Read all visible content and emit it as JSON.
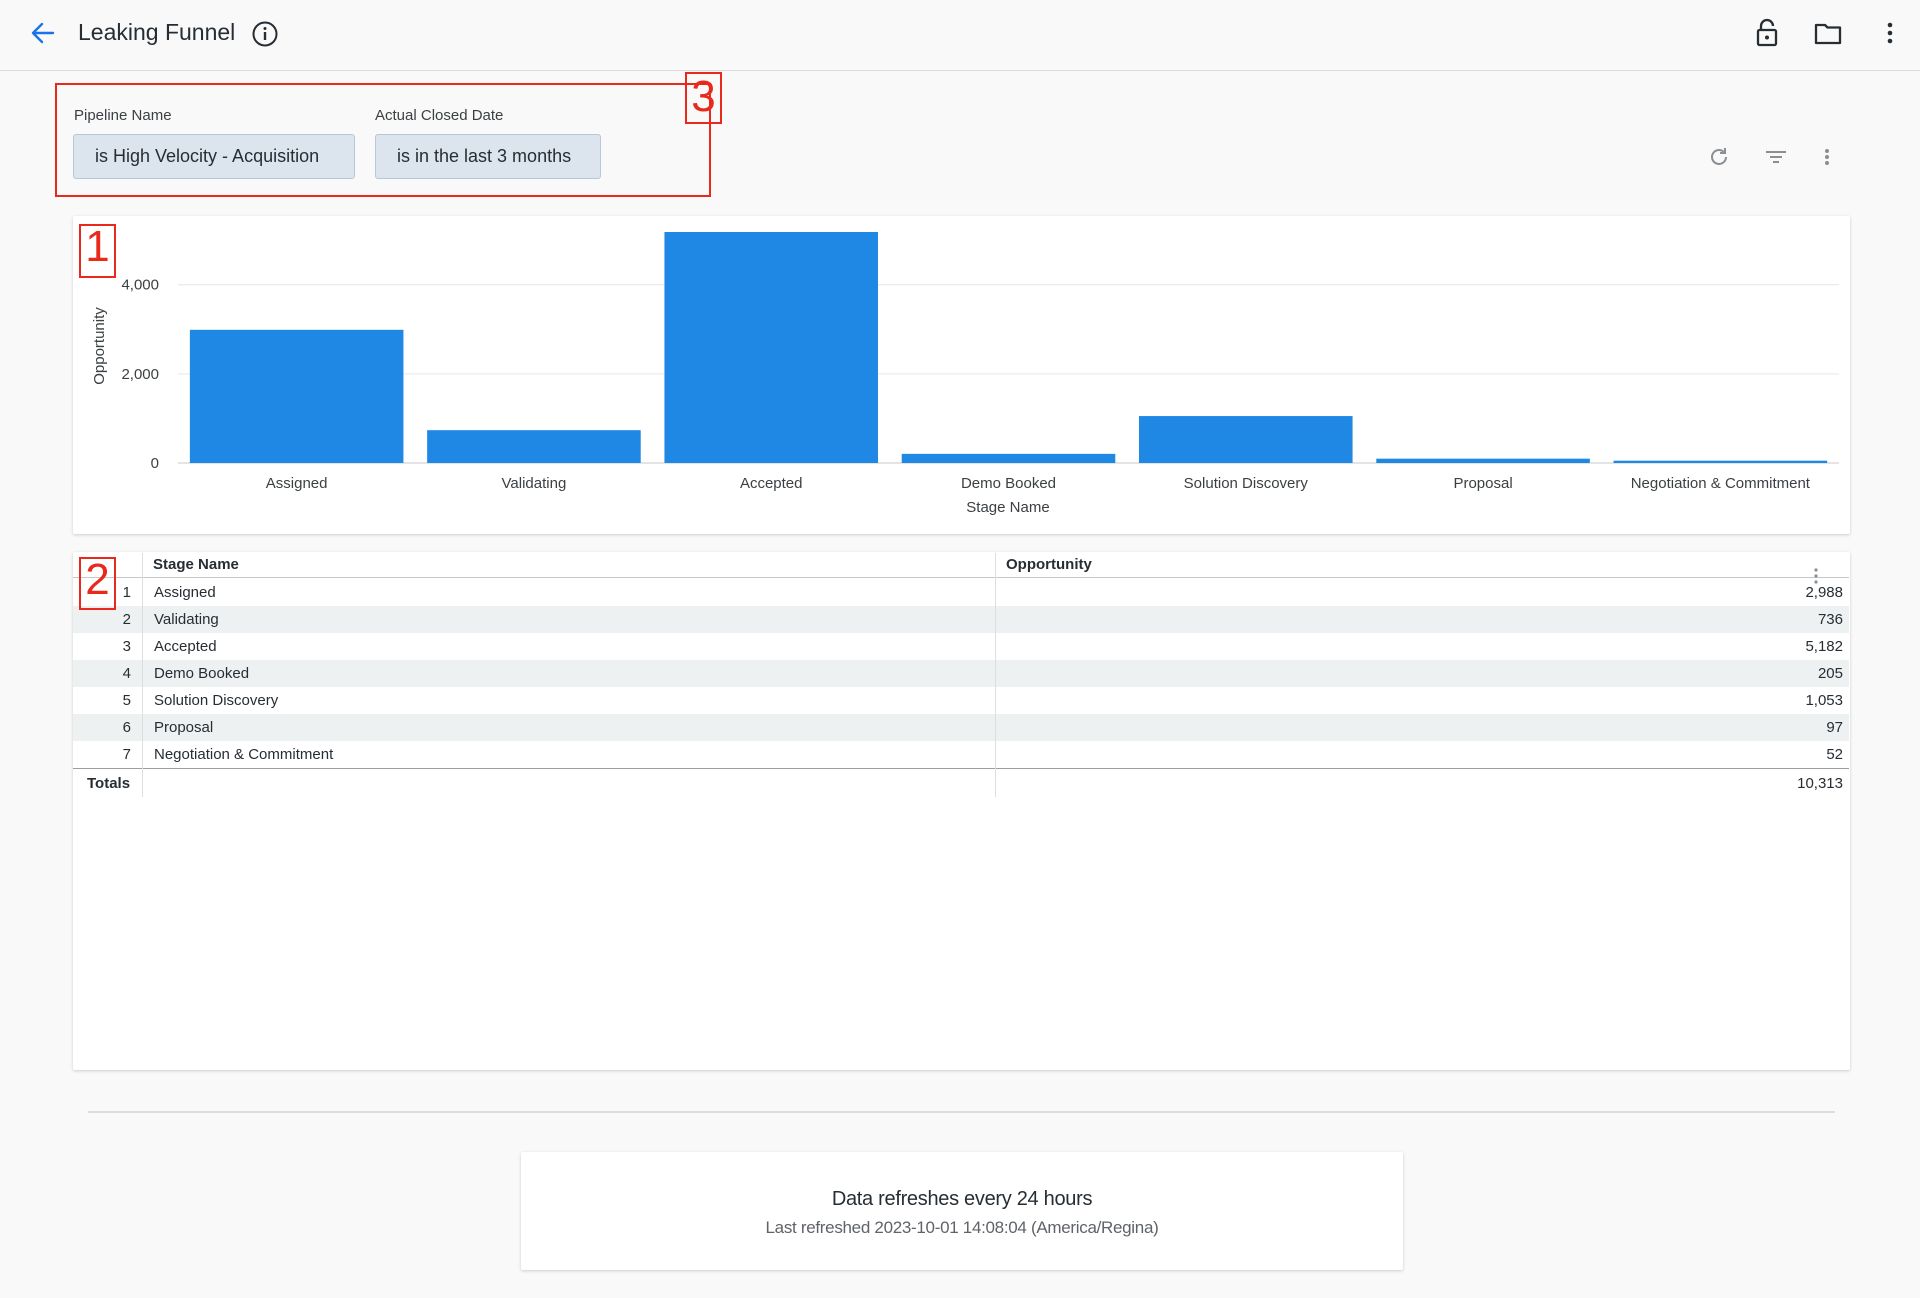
{
  "header": {
    "title": "Leaking Funnel",
    "icons": [
      "back-arrow-icon",
      "info-icon",
      "lock-icon",
      "folder-icon",
      "more-vertical-icon"
    ]
  },
  "annotations": [
    "1",
    "2",
    "3"
  ],
  "filters": [
    {
      "label": "Pipeline Name",
      "value": "is High Velocity - Acquisition"
    },
    {
      "label": "Actual Closed Date",
      "value": "is in the last 3 months"
    }
  ],
  "toolbar_icons": [
    "refresh-icon",
    "filter-icon",
    "more-vertical-icon"
  ],
  "chart_data": {
    "type": "bar",
    "categories": [
      "Assigned",
      "Validating",
      "Accepted",
      "Demo Booked",
      "Solution Discovery",
      "Proposal",
      "Negotiation & Commitment"
    ],
    "values": [
      2988,
      736,
      5182,
      205,
      1053,
      97,
      52
    ],
    "xlabel": "Stage Name",
    "ylabel": "Opportunity",
    "ylim": [
      0,
      5182
    ],
    "yticks": [
      0,
      2000,
      4000
    ],
    "ytick_labels": [
      "0",
      "2,000",
      "4,000"
    ],
    "grid": true,
    "color": "#1f88e5"
  },
  "table": {
    "columns": [
      "Stage Name",
      "Opportunity"
    ],
    "rows": [
      {
        "index": "1",
        "stage": "Assigned",
        "value": "2,988"
      },
      {
        "index": "2",
        "stage": "Validating",
        "value": "736"
      },
      {
        "index": "3",
        "stage": "Accepted",
        "value": "5,182"
      },
      {
        "index": "4",
        "stage": "Demo Booked",
        "value": "205"
      },
      {
        "index": "5",
        "stage": "Solution Discovery",
        "value": "1,053"
      },
      {
        "index": "6",
        "stage": "Proposal",
        "value": "97"
      },
      {
        "index": "7",
        "stage": "Negotiation & Commitment",
        "value": "52"
      }
    ],
    "totals_label": "Totals",
    "totals_value": "10,313"
  },
  "footer": {
    "refresh_title": "Data refreshes every 24 hours",
    "refresh_sub": "Last refreshed 2023-10-01 14:08:04 (America/Regina)"
  }
}
